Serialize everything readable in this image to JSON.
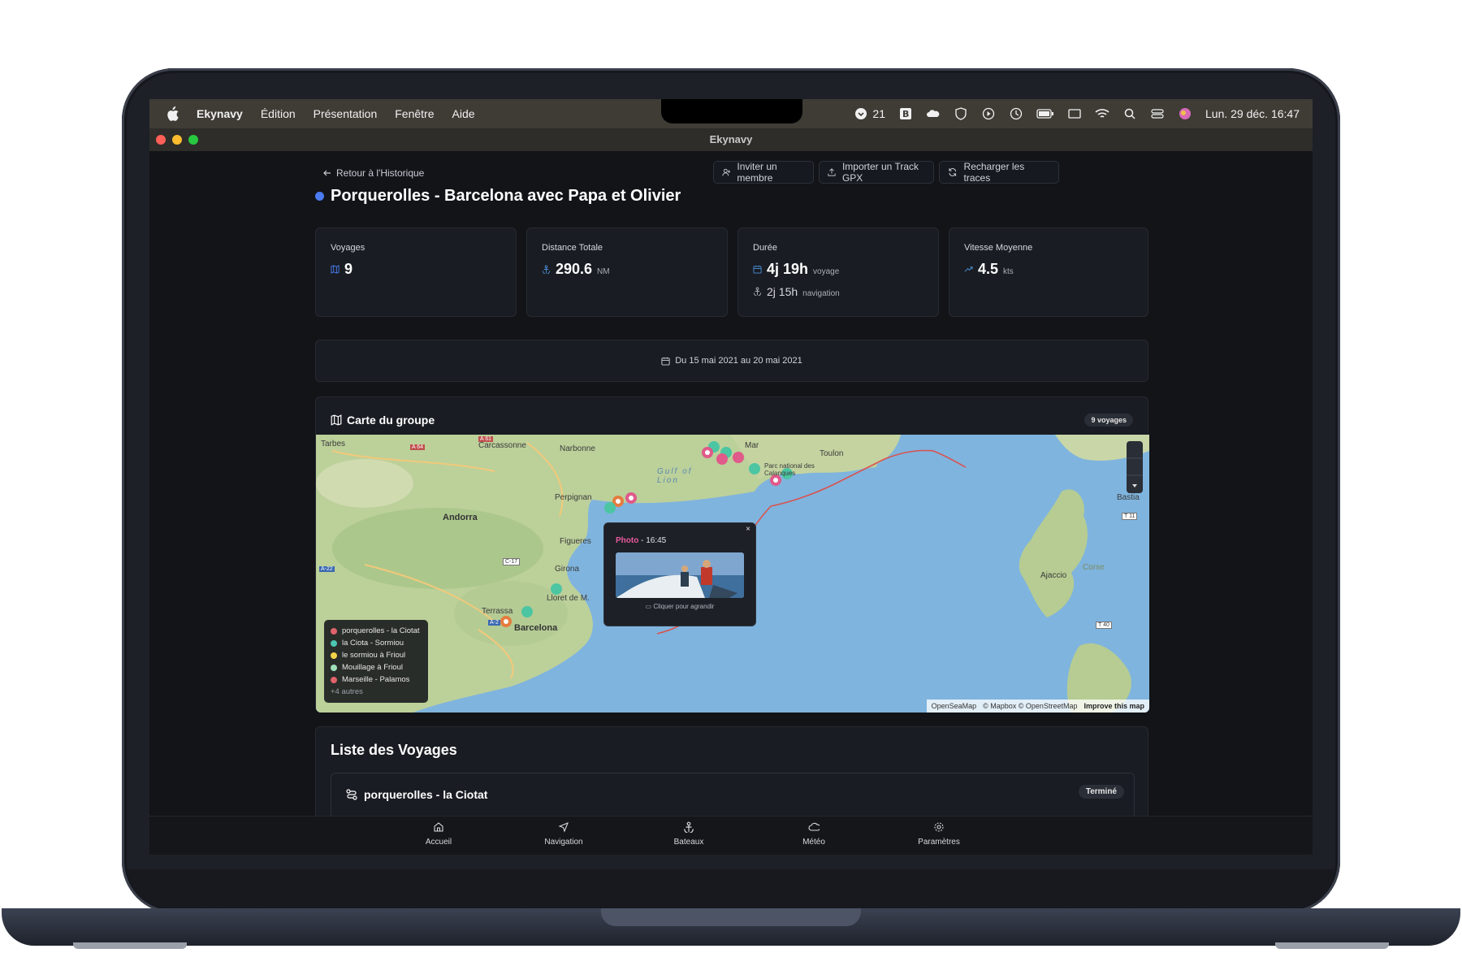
{
  "menubar": {
    "app_name": "Ekynavy",
    "menus": [
      "Édition",
      "Présentation",
      "Fenêtre",
      "Aide"
    ],
    "badge_count": "21",
    "datetime": "Lun. 29 déc. 16:47"
  },
  "window": {
    "title": "Ekynavy"
  },
  "topbar": {
    "back_label": "Retour à l'Historique",
    "invite_label": "Inviter un membre",
    "import_label": "Importer un Track GPX",
    "reload_label": "Recharger les traces"
  },
  "page": {
    "title": "Porquerolles - Barcelona avec Papa et Olivier",
    "title_dot_color": "#4a7cf0"
  },
  "stats": {
    "voyages": {
      "label": "Voyages",
      "value": "9"
    },
    "distance": {
      "label": "Distance Totale",
      "value": "290.6",
      "unit": "NM"
    },
    "duration": {
      "label": "Durée",
      "value": "4j 19h",
      "unit": "voyage",
      "nav_value": "2j 15h",
      "nav_unit": "navigation"
    },
    "speed": {
      "label": "Vitesse Moyenne",
      "value": "4.5",
      "unit": "kts"
    }
  },
  "date_range": "Du 15 mai 2021 au 20 mai 2021",
  "map": {
    "title": "Carte du groupe",
    "badge": "9 voyages",
    "labels": {
      "tarbes": "Tarbes",
      "carcassonne": "Carcassonne",
      "narbonne": "Narbonne",
      "perpignan": "Perpignan",
      "andorra": "Andorra",
      "figueres": "Figueres",
      "girona": "Girona",
      "lloret": "Lloret de M.",
      "terrassa": "Terrassa",
      "barcelona": "Barcelona",
      "marseille": "Mar",
      "toulon": "Toulon",
      "calanques": "Parc national des Calanques",
      "gulf": "Gulf of Lion",
      "bastia": "Bastia",
      "corse": "Corse",
      "ajaccio": "Ajaccio",
      "a61": "A 61",
      "a64": "A 64",
      "a22": "A-22",
      "a2": "A-2",
      "c17": "C-17",
      "t11": "T 11",
      "t40": "T 40"
    },
    "legend": [
      {
        "label": "porquerolles - la Ciotat",
        "color": "#e0626a"
      },
      {
        "label": "la Ciota - Sormiou",
        "color": "#4cc5b2"
      },
      {
        "label": "le sormiou à Frioul",
        "color": "#f2d24a"
      },
      {
        "label": "Mouillage à Frioul",
        "color": "#9fe0b8"
      },
      {
        "label": "Marseille - Palamos",
        "color": "#e0626a"
      }
    ],
    "legend_more": "+4 autres",
    "popup": {
      "type": "Photo",
      "time": "- 16:45",
      "close": "×",
      "hint": "Cliquer pour agrandir"
    },
    "attribution": {
      "osm": "OpenSeaMap",
      "mapbox": "© Mapbox © OpenStreetMap",
      "improve": "Improve this map"
    }
  },
  "list": {
    "title": "Liste des Voyages",
    "trips": [
      {
        "name": "porquerolles - la Ciotat",
        "status": "Terminé"
      }
    ]
  },
  "tabs": [
    "Accueil",
    "Navigation",
    "Bateaux",
    "Météo",
    "Paramètres"
  ]
}
